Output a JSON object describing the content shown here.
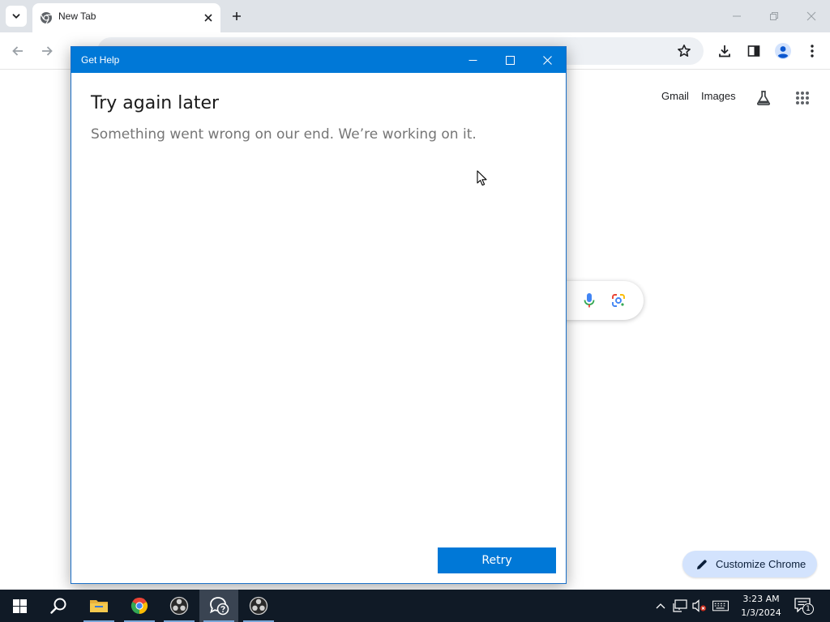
{
  "browser": {
    "tab": {
      "title": "New Tab"
    },
    "google_links": {
      "gmail": "Gmail",
      "images": "Images"
    },
    "customize_label": "Customize Chrome"
  },
  "dialog": {
    "title": "Get Help",
    "heading": "Try again later",
    "message": "Something went wrong on our end. We’re working on it.",
    "retry_label": "Retry"
  },
  "taskbar": {
    "apps": [
      "windows-start",
      "search",
      "file-explorer",
      "chrome",
      "obs-studio",
      "get-help",
      "obs-studio"
    ],
    "clock_time": "3:23 AM",
    "clock_date": "1/3/2024",
    "notification_count": "1"
  },
  "colors": {
    "accent": "#0078d7",
    "tabstrip": "#dfe3e8",
    "customize_button": "#d3e3fd",
    "taskbar": "#101a26"
  },
  "icons": {
    "tab_search": "chevron-down-icon",
    "favicon": "chrome-icon",
    "bookmark": "star-icon",
    "download": "download-icon",
    "side_panel": "side-panel-icon",
    "profile": "profile-icon",
    "menu": "kebab-menu-icon",
    "labs": "labs-flask-icon",
    "apps": "apps-grid-icon",
    "voice": "microphone-icon",
    "lens": "google-lens-icon",
    "customize": "pencil-icon"
  }
}
